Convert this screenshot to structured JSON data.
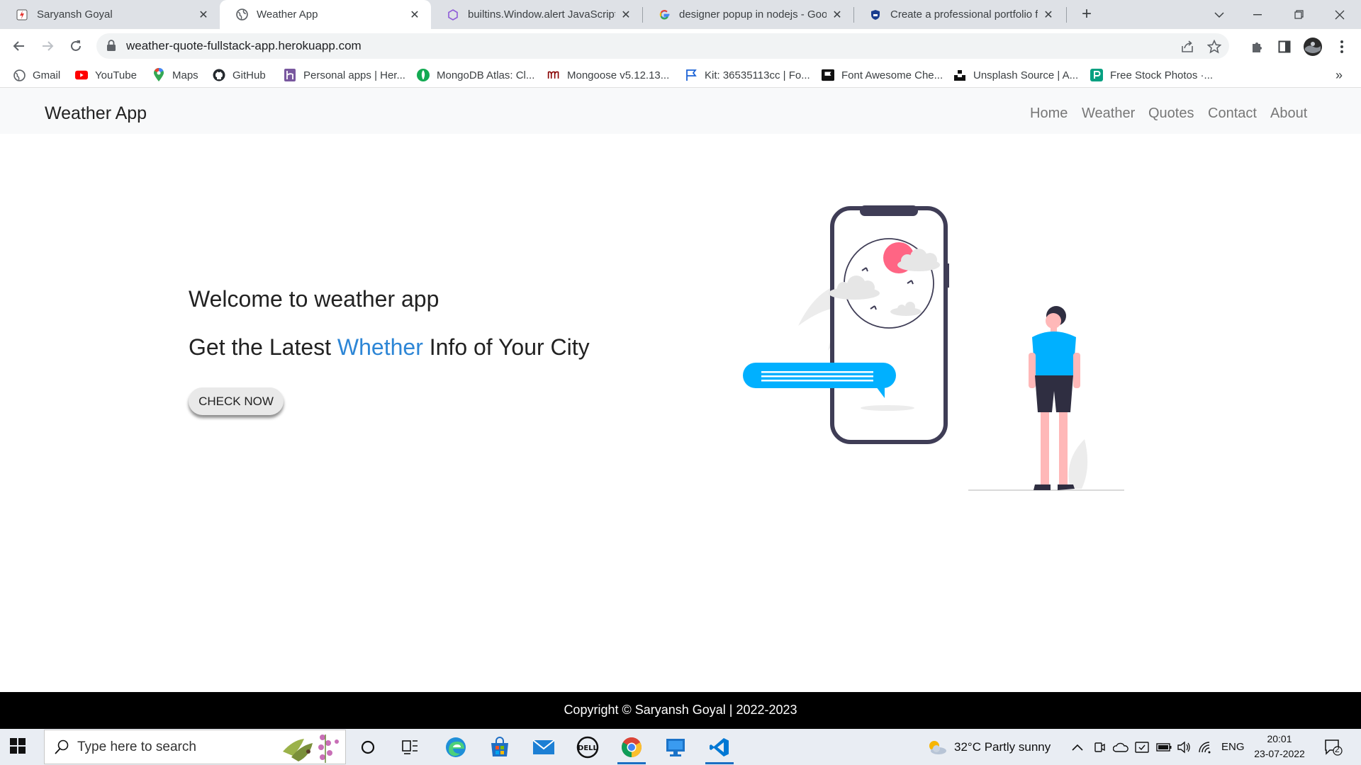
{
  "browser": {
    "tabs": [
      {
        "title": "Saryansh Goyal",
        "active": false
      },
      {
        "title": "Weather App",
        "active": true
      },
      {
        "title": "builtins.Window.alert JavaScript a",
        "active": false
      },
      {
        "title": "designer popup in nodejs - Goog",
        "active": false
      },
      {
        "title": "Create a professional portfolio fo",
        "active": false
      }
    ],
    "new_tab": "+",
    "url": "weather-quote-fullstack-app.herokuapp.com",
    "bookmarks": [
      {
        "label": "Gmail",
        "icon": "gmail-icon"
      },
      {
        "label": "YouTube",
        "icon": "youtube-icon"
      },
      {
        "label": "Maps",
        "icon": "maps-icon"
      },
      {
        "label": "GitHub",
        "icon": "github-icon"
      },
      {
        "label": "Personal apps | Her...",
        "icon": "heroku-icon"
      },
      {
        "label": "MongoDB Atlas: Cl...",
        "icon": "mongodb-icon"
      },
      {
        "label": "Mongoose v5.12.13...",
        "icon": "mongoose-icon"
      },
      {
        "label": "Kit: 36535113cc | Fo...",
        "icon": "flag-icon"
      },
      {
        "label": "Font Awesome Che...",
        "icon": "font-awesome-icon"
      },
      {
        "label": "Unsplash Source | A...",
        "icon": "unsplash-icon"
      },
      {
        "label": "Free Stock Photos ·...",
        "icon": "pexels-icon"
      }
    ],
    "bookmarks_more": "»"
  },
  "page": {
    "brand": "Weather App",
    "nav": [
      "Home",
      "Weather",
      "Quotes",
      "Contact",
      "About"
    ],
    "hero": {
      "title": "Welcome to weather app",
      "subtitle_before": "Get the Latest ",
      "subtitle_highlight": "Whether",
      "subtitle_after": " Info of Your City",
      "cta": "CHECK NOW"
    },
    "footer": "Copyright © Saryansh Goyal | 2022-2023",
    "colors": {
      "highlight": "#2d86d6",
      "illustration_accent": "#00b0ff",
      "sun": "#ff6584",
      "phone_frame": "#3f3d56"
    }
  },
  "taskbar": {
    "search_placeholder": "Type here to search",
    "weather": "32°C  Partly sunny",
    "language": "ENG",
    "time": "20:01",
    "date": "23-07-2022",
    "notifications": "2"
  }
}
